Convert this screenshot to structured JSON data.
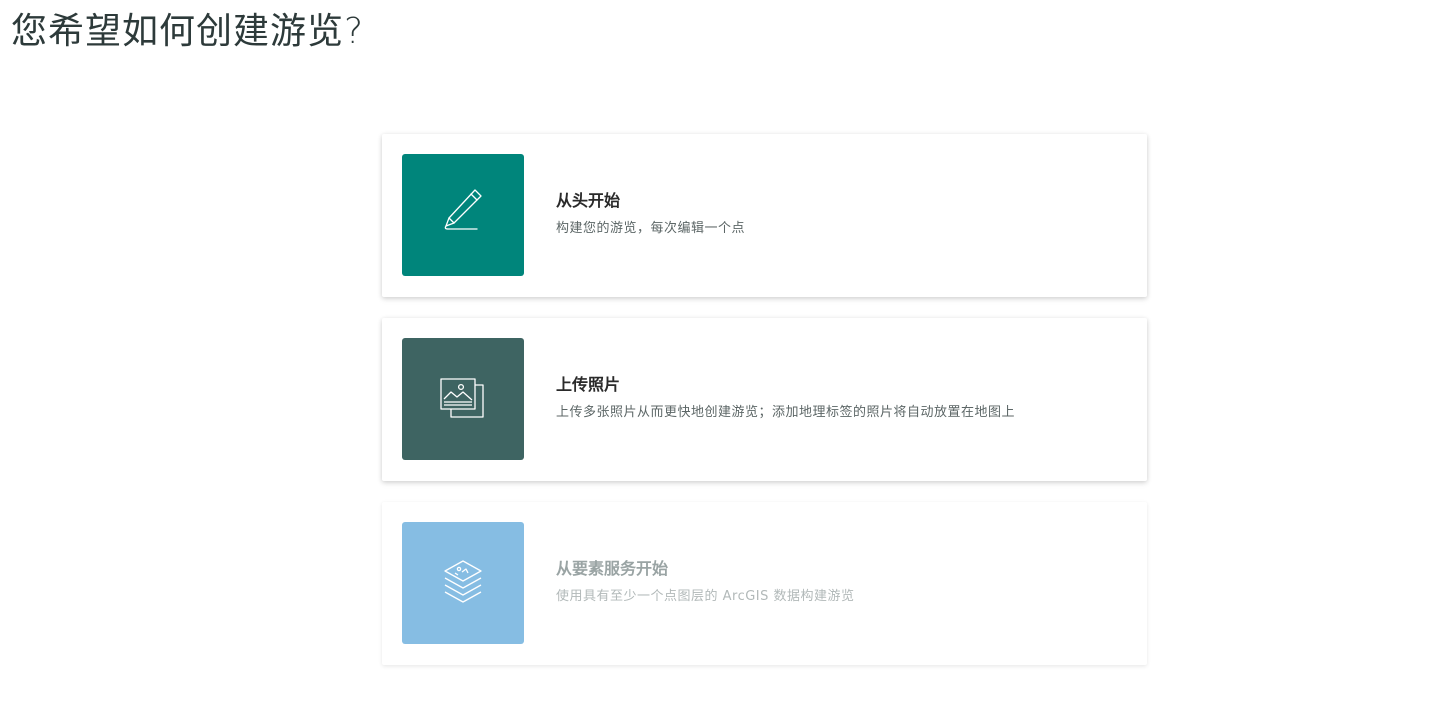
{
  "page": {
    "title": "您希望如何创建游览?"
  },
  "options": [
    {
      "title": "从头开始",
      "description": "构建您的游览，每次编辑一个点",
      "icon": "pencil-icon",
      "icon_bg": "#00857b",
      "enabled": true
    },
    {
      "title": "上传照片",
      "description": "上传多张照片从而更快地创建游览；添加地理标签的照片将自动放置在地图上",
      "icon": "photos-icon",
      "icon_bg": "#3e6462",
      "enabled": true
    },
    {
      "title": "从要素服务开始",
      "description": "使用具有至少一个点图层的 ArcGIS 数据构建游览",
      "icon": "layers-icon",
      "icon_bg": "#86bde3",
      "enabled": false
    }
  ]
}
